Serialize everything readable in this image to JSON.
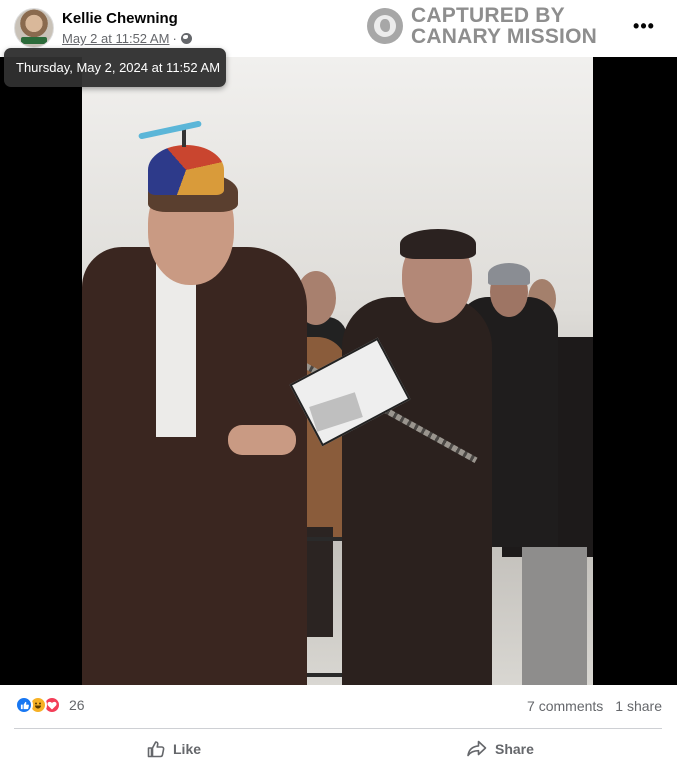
{
  "post": {
    "author": "Kellie Chewning",
    "date": "May 2 at 11:52 AM",
    "separator": "·",
    "audience_icon": "globe-icon",
    "tooltip": "Thursday, May 2, 2024 at 11:52 AM",
    "more_label": "•••"
  },
  "watermark": {
    "line1": "CAPTURED BY",
    "line2": "CANARY MISSION",
    "logo_icon": "canary-bird-icon"
  },
  "engagement": {
    "reaction_icons": [
      "like-icon",
      "haha-icon",
      "love-icon"
    ],
    "reaction_count": "26",
    "comments": "7 comments",
    "shares": "1 share"
  },
  "actions": {
    "like_label": "Like",
    "share_label": "Share"
  },
  "colors": {
    "like_blue": "#1877f2",
    "love_red": "#f33e58",
    "haha_yellow": "#f7b125",
    "meta_gray": "#65676b"
  }
}
